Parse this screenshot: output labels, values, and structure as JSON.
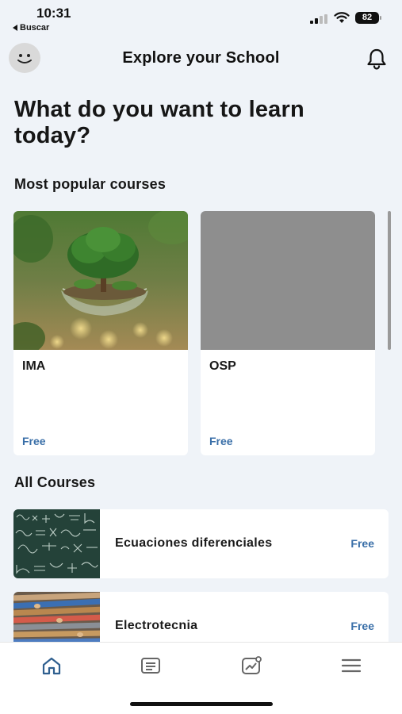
{
  "status_bar": {
    "time": "10:31",
    "back_app": "Buscar",
    "battery": "82"
  },
  "header": {
    "title": "Explore your School",
    "avatar_icon": "smiley-avatar-icon",
    "notification_icon": "bell-icon"
  },
  "hero": {
    "line1": "What do you want to learn",
    "line2": "today?"
  },
  "popular": {
    "title": "Most popular courses",
    "courses": [
      {
        "title": "IMA",
        "price": "Free",
        "image": "tree-in-glass-sphere"
      },
      {
        "title": "OSP",
        "price": "Free",
        "image": "gray-placeholder"
      }
    ]
  },
  "all_courses": {
    "title": "All Courses",
    "courses": [
      {
        "title": "Ecuaciones diferenciales",
        "price": "Free",
        "image": "chalkboard-equations"
      },
      {
        "title": "Electrotecnia",
        "price": "Free",
        "image": "electrical-cables"
      }
    ]
  },
  "tabbar": {
    "icons": [
      "home-icon",
      "courses-icon",
      "progress-icon",
      "menu-icon"
    ],
    "active_color": "#2f5f8f",
    "inactive_color": "#666666"
  },
  "colors": {
    "background": "#eff3f8",
    "price": "#3a6fa8"
  }
}
